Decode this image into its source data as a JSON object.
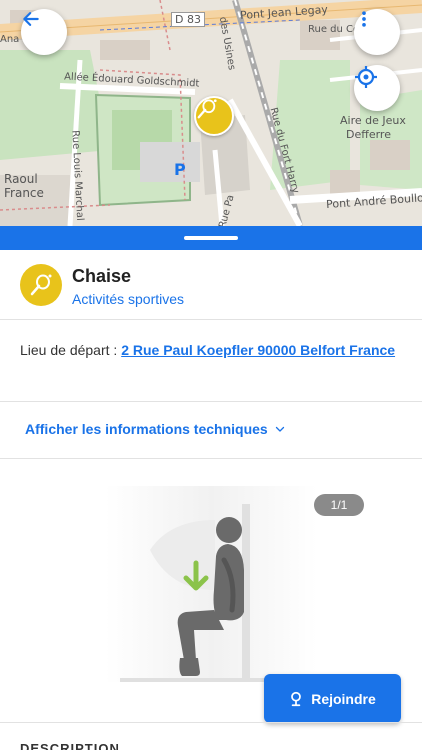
{
  "map": {
    "labels": {
      "d83": "D 83",
      "pont_jean_legay": "Pont Jean Legay",
      "rue_du_cou": "Rue du Cou",
      "ruedes": "Rue des",
      "usines": "des Usines",
      "allee": "Allée Édouard Goldschmidt",
      "rue_du_fort_harry": "Rue du Fort Harry",
      "aire_de_jeux": "Aire de Jeux",
      "defferre": "Defferre",
      "raoul": "Raoul",
      "france": "France",
      "rue_louis_marchal": "Rue Louis Marchal",
      "rue_pa": "Rue Pa",
      "pont_andre": "Pont André Boulloche",
      "parking": "P",
      "ana": "Ana",
      "rue_fr": "Rue F"
    }
  },
  "poi": {
    "title": "Chaise",
    "category": "Activités sportives"
  },
  "departure": {
    "label": "Lieu de départ : ",
    "address": "2 Rue Paul Koepfler 90000 Belfort France"
  },
  "tech": {
    "label": "Afficher les informations techniques"
  },
  "gallery": {
    "counter": "1/1"
  },
  "actions": {
    "join_label": "Rejoindre"
  },
  "description": {
    "heading": "DESCRIPTION"
  },
  "colors": {
    "accent": "#1a73e8",
    "marker": "#e8c31b"
  },
  "icons": {
    "back": "arrow-left-icon",
    "menu": "more-vertical-icon",
    "locate": "crosshair-icon",
    "poi": "tennis-racket-icon",
    "chevron": "chevron-down-icon",
    "join": "location-pin-icon"
  }
}
